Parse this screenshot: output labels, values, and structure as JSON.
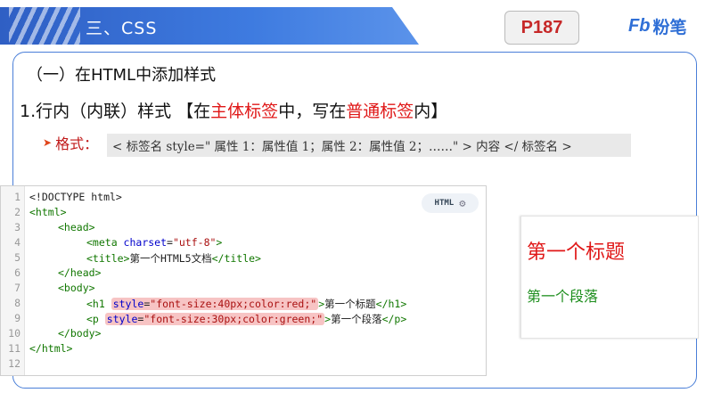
{
  "header": {
    "title": "三、CSS",
    "page": "P187",
    "logo_mark": "Fb",
    "logo_text": "粉笔"
  },
  "section_title": "（一）在HTML中添加样式",
  "subtitle": {
    "part1": "1.行内（内联）样式 【在",
    "red1": "主体标签",
    "part2": "中，写在",
    "red2": "普通标签",
    "part3": "内】"
  },
  "format": {
    "label": "格式：",
    "code": "< 标签名 style=\" 属性 1：属性值 1；属性 2：属性值 2；……\" > 内容 </ 标签名 >"
  },
  "code_panel": {
    "badge": "HTML",
    "lines": {
      "l1": "<!DOCTYPE html>",
      "l2": "<html>",
      "l3": "<head>",
      "l4_open": "<meta ",
      "l4_attr": "charset",
      "l4_eq": "=",
      "l4_val": "\"utf-8\"",
      "l4_close": ">",
      "l5_open": "<title>",
      "l5_text": "第一个HTML5文档",
      "l5_close": "</title>",
      "l6": "</head>",
      "l7": "<body>",
      "l8_open": "<h1 ",
      "l8_attr": "style",
      "l8_eq": "=",
      "l8_val": "\"font-size:40px;color:red;\"",
      "l8_gt": ">",
      "l8_text": "第一个标题",
      "l8_close": "</h1>",
      "l9_open": "<p ",
      "l9_attr": "style",
      "l9_eq": "=",
      "l9_val": "\"font-size:30px;color:green;\"",
      "l9_gt": ">",
      "l9_text": "第一个段落",
      "l9_close": "</p>",
      "l10": "</body>",
      "l11": "</html>"
    },
    "numbers": [
      "1",
      "2",
      "3",
      "4",
      "5",
      "6",
      "7",
      "8",
      "9",
      "10",
      "11",
      "12"
    ]
  },
  "preview": {
    "heading": "第一个标题",
    "paragraph": "第一个段落"
  },
  "colors": {
    "accent_blue": "#3e7be0",
    "red": "#e01818",
    "green": "#1f8f1f"
  }
}
